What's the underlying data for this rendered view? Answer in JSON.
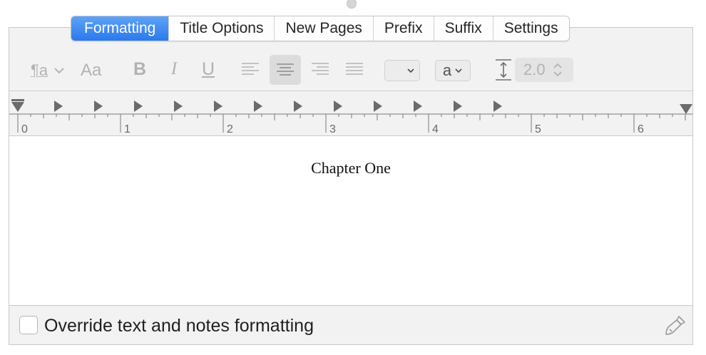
{
  "tabs": [
    {
      "label": "Formatting",
      "active": true
    },
    {
      "label": "Title Options",
      "active": false
    },
    {
      "label": "New Pages",
      "active": false
    },
    {
      "label": "Prefix",
      "active": false
    },
    {
      "label": "Suffix",
      "active": false
    },
    {
      "label": "Settings",
      "active": false
    }
  ],
  "toolbar": {
    "style_popup_glyph": "¶a",
    "font_button": "Aa",
    "bold": "B",
    "italic": "I",
    "underline": "U",
    "alignment_selected": "center",
    "text_color_popup_label": "a",
    "line_spacing_value": "2.0"
  },
  "ruler": {
    "labels": [
      "0",
      "1",
      "2",
      "3",
      "4",
      "5",
      "6"
    ]
  },
  "editor": {
    "text": "Chapter One"
  },
  "footer": {
    "override_label": "Override text and notes formatting",
    "override_checked": false
  },
  "colors": {
    "accent": "#2a79ec",
    "panel": "#f2f2f2",
    "disabled": "#b1b1b1"
  }
}
